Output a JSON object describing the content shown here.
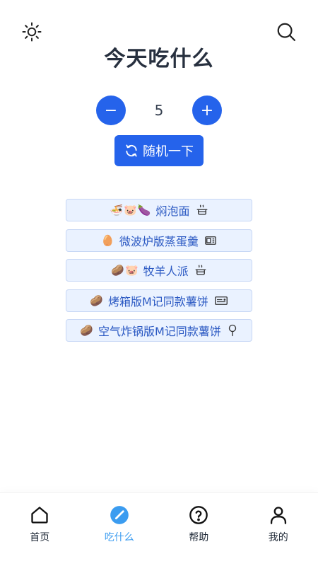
{
  "header": {
    "title": "今天吃什么",
    "left_icon": "sun-icon",
    "right_icon": "search-icon"
  },
  "stepper": {
    "minus_label": "−",
    "count": "5",
    "plus_label": "+"
  },
  "random_button": {
    "label": "随机一下",
    "icon": "refresh-icon"
  },
  "dishes": [
    {
      "emojis": "🍜🐷🍆",
      "name": "焖泡面",
      "tool_icon": "rice-cooker-icon"
    },
    {
      "emojis": "🥚",
      "name": "微波炉版蒸蛋羹",
      "tool_icon": "microwave-icon"
    },
    {
      "emojis": "🥔🐷",
      "name": "牧羊人派",
      "tool_icon": "rice-cooker-icon"
    },
    {
      "emojis": "🥔",
      "name": "烤箱版M记同款薯饼",
      "tool_icon": "oven-icon"
    },
    {
      "emojis": "🥔",
      "name": "空气炸锅版M记同款薯饼",
      "tool_icon": "air-fryer-icon"
    }
  ],
  "tabbar": {
    "tabs": [
      {
        "label": "首页",
        "icon": "home-icon",
        "active": false
      },
      {
        "label": "吃什么",
        "icon": "compass-icon",
        "active": true
      },
      {
        "label": "帮助",
        "icon": "help-icon",
        "active": false
      },
      {
        "label": "我的",
        "icon": "user-icon",
        "active": false
      }
    ]
  },
  "colors": {
    "primary": "#2563eb",
    "tab_active": "#3b9cf0",
    "dish_bg": "#eaf2ff",
    "dish_text": "#2b59c3"
  }
}
